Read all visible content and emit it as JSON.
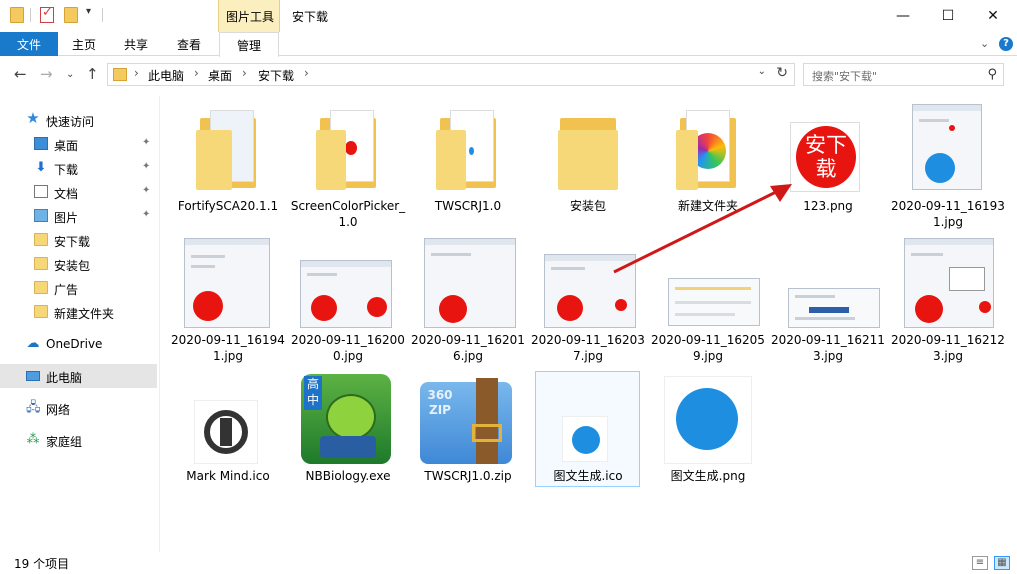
{
  "title_bar": {
    "contextual_tab": "图片工具",
    "window_title": "安下载",
    "minimize": "—",
    "maximize": "☐",
    "close": "✕"
  },
  "ribbon": {
    "file_tab": "文件",
    "tabs": [
      "主页",
      "共享",
      "查看"
    ],
    "manage_tab": "管理",
    "expand_icon": "⌄",
    "help_icon": "?"
  },
  "address": {
    "back": "←",
    "forward": "→",
    "recent": "⌄",
    "up": "↑",
    "crumbs": [
      "此电脑",
      "桌面",
      "安下载"
    ],
    "separator": "›",
    "dropdown": "⌄",
    "refresh": "↻"
  },
  "search": {
    "placeholder": "搜索\"安下载\"",
    "icon": "⚲"
  },
  "sidebar": {
    "quick_access": "快速访问",
    "items": [
      {
        "label": "桌面",
        "icon": "desktop-icon",
        "pinned": true
      },
      {
        "label": "下载",
        "icon": "download-icon",
        "pinned": true
      },
      {
        "label": "文档",
        "icon": "document-icon",
        "pinned": true
      },
      {
        "label": "图片",
        "icon": "picture-icon",
        "pinned": true
      },
      {
        "label": "安下载",
        "icon": "folder-icon",
        "pinned": false
      },
      {
        "label": "安装包",
        "icon": "folder-icon",
        "pinned": false
      },
      {
        "label": "广告",
        "icon": "folder-icon",
        "pinned": false
      },
      {
        "label": "新建文件夹",
        "icon": "folder-icon",
        "pinned": false
      }
    ],
    "onedrive": "OneDrive",
    "this_pc": "此电脑",
    "network": "网络",
    "homegroup": "家庭组",
    "pin_glyph": "✦"
  },
  "files": [
    {
      "name": "FortifySCA20.1.1",
      "type": "folder"
    },
    {
      "name": "ScreenColorPicker_1.0",
      "type": "folder"
    },
    {
      "name": "TWSCRJ1.0",
      "type": "folder"
    },
    {
      "name": "安装包",
      "type": "folder"
    },
    {
      "name": "新建文件夹",
      "type": "folder"
    },
    {
      "name": "123.png",
      "type": "image",
      "thumb_text": "安下\n载"
    },
    {
      "name": "2020-09-11_161931.jpg",
      "type": "screenshot"
    },
    {
      "name": "2020-09-11_161941.jpg",
      "type": "screenshot"
    },
    {
      "name": "2020-09-11_162000.jpg",
      "type": "screenshot"
    },
    {
      "name": "2020-09-11_162016.jpg",
      "type": "screenshot"
    },
    {
      "name": "2020-09-11_162037.jpg",
      "type": "screenshot"
    },
    {
      "name": "2020-09-11_162059.jpg",
      "type": "screenshot"
    },
    {
      "name": "2020-09-11_162113.jpg",
      "type": "screenshot"
    },
    {
      "name": "2020-09-11_162123.jpg",
      "type": "screenshot"
    },
    {
      "name": "Mark Mind.ico",
      "type": "icon"
    },
    {
      "name": "NBBiology.exe",
      "type": "app",
      "badge": "高\n中"
    },
    {
      "name": "TWSCRJ1.0.zip",
      "type": "zip",
      "badge": "360\nZIP"
    },
    {
      "name": "图文生成.ico",
      "type": "icon"
    },
    {
      "name": "图文生成.png",
      "type": "image"
    }
  ],
  "status": {
    "count": "19 个项目"
  },
  "colors": {
    "accent": "#1979ca",
    "contextual": "#fbefc0",
    "selection": "#e5e5e5",
    "red": "#e8140f",
    "blue": "#1e8fe0"
  }
}
